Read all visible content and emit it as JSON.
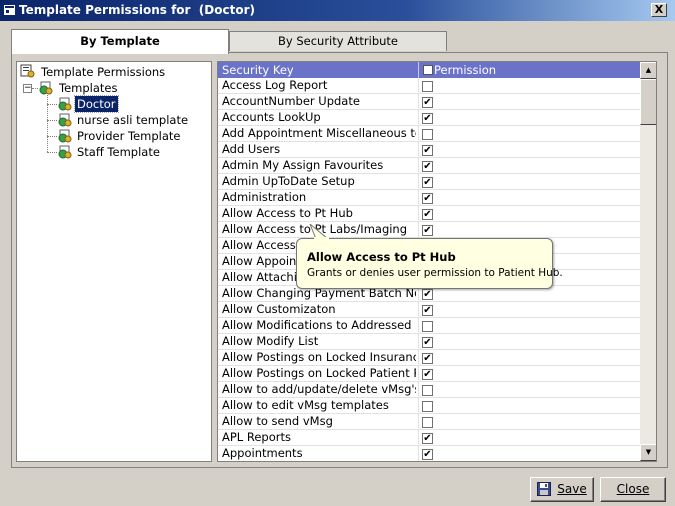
{
  "window": {
    "title": "Template Permissions for  (Doctor)",
    "close_label": "X"
  },
  "tabs": [
    {
      "label": "By Template"
    },
    {
      "label": "By Security Attribute"
    }
  ],
  "tree": {
    "root": "Template Permissions",
    "group": "Templates",
    "expander": "−",
    "items": [
      {
        "label": "Doctor"
      },
      {
        "label": "nurse asli template"
      },
      {
        "label": "Provider Template"
      },
      {
        "label": "Staff Template"
      }
    ]
  },
  "grid": {
    "col_key": "Security Key",
    "col_permission": "Permission",
    "check_mark": "✔",
    "rows": [
      {
        "key": "Access Log Report",
        "checked": false
      },
      {
        "key": "AccountNumber Update",
        "checked": true
      },
      {
        "key": "Accounts LookUp",
        "checked": true
      },
      {
        "key": "Add Appointment Miscellaneous to",
        "checked": false
      },
      {
        "key": "Add Users",
        "checked": true
      },
      {
        "key": "Admin My Assign Favourites",
        "checked": true
      },
      {
        "key": "Admin UpToDate Setup",
        "checked": true
      },
      {
        "key": "Administration",
        "checked": true
      },
      {
        "key": "Allow Access to Pt Hub",
        "checked": true
      },
      {
        "key": "Allow Access to Pt Labs/Imaging",
        "checked": true
      },
      {
        "key": "Allow Access",
        "checked": true
      },
      {
        "key": "Allow Appoin",
        "checked": true
      },
      {
        "key": "Allow Attachi",
        "checked": true
      },
      {
        "key": "Allow Changing Payment Batch No",
        "checked": true
      },
      {
        "key": "Allow Customizaton",
        "checked": true
      },
      {
        "key": "Allow Modifications to Addressed F",
        "checked": false
      },
      {
        "key": "Allow Modify List",
        "checked": true
      },
      {
        "key": "Allow Postings on Locked Insuranc",
        "checked": true
      },
      {
        "key": "Allow Postings on Locked Patient P",
        "checked": true
      },
      {
        "key": "Allow to add/update/delete vMsg's",
        "checked": false
      },
      {
        "key": "Allow to edit vMsg templates",
        "checked": false
      },
      {
        "key": "Allow to send vMsg",
        "checked": false
      },
      {
        "key": "APL Reports",
        "checked": true
      },
      {
        "key": "Appointments",
        "checked": true
      }
    ]
  },
  "tooltip": {
    "title": "Allow Access to Pt Hub",
    "body": "Grants or denies user permission to Patient Hub."
  },
  "buttons": {
    "save": "Save",
    "close": "Close"
  }
}
